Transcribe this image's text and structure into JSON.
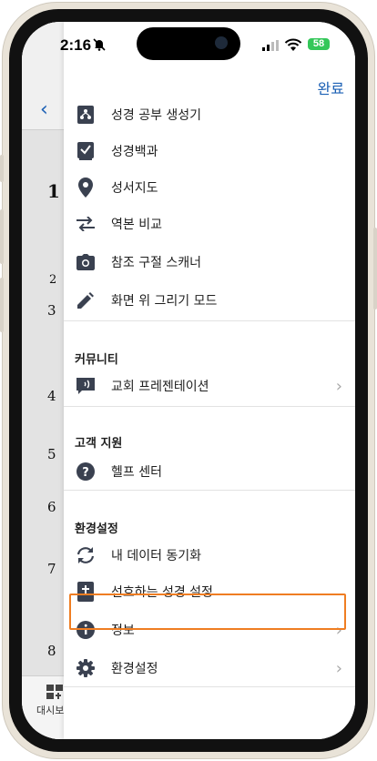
{
  "status": {
    "time": "2:16",
    "battery": "58"
  },
  "header": {
    "done_label": "완료"
  },
  "bg_app": {
    "verses": [
      "1",
      "2",
      "3",
      "4",
      "5",
      "6",
      "7",
      "8"
    ],
    "dashboard_label": "대시보"
  },
  "menu": {
    "items": [
      {
        "label": "성경 공부 생성기",
        "icon": "study-builder-icon"
      },
      {
        "label": "성경백과",
        "icon": "encyclopedia-icon"
      },
      {
        "label": "성서지도",
        "icon": "map-pin-icon"
      },
      {
        "label": "역본 비교",
        "icon": "compare-arrows-icon"
      },
      {
        "label": "참조 구절 스캐너",
        "icon": "camera-icon"
      },
      {
        "label": "화면 위 그리기 모드",
        "icon": "pencil-icon"
      }
    ]
  },
  "community": {
    "title": "커뮤니티",
    "items": [
      {
        "label": "교회 프레젠테이션",
        "icon": "presentation-icon"
      }
    ]
  },
  "support": {
    "title": "고객 지원",
    "items": [
      {
        "label": "헬프 센터",
        "icon": "help-icon"
      }
    ]
  },
  "settings": {
    "title": "환경설정",
    "items": [
      {
        "label": "내 데이터 동기화",
        "icon": "sync-icon"
      },
      {
        "label": "선호하는 성경 설정",
        "icon": "bible-icon"
      },
      {
        "label": "정보",
        "icon": "info-icon"
      },
      {
        "label": "환경설정",
        "icon": "gear-icon"
      }
    ]
  },
  "colors": {
    "accent": "#1a5fb4",
    "highlight": "#ef7d22",
    "icon": "#3a4150"
  }
}
